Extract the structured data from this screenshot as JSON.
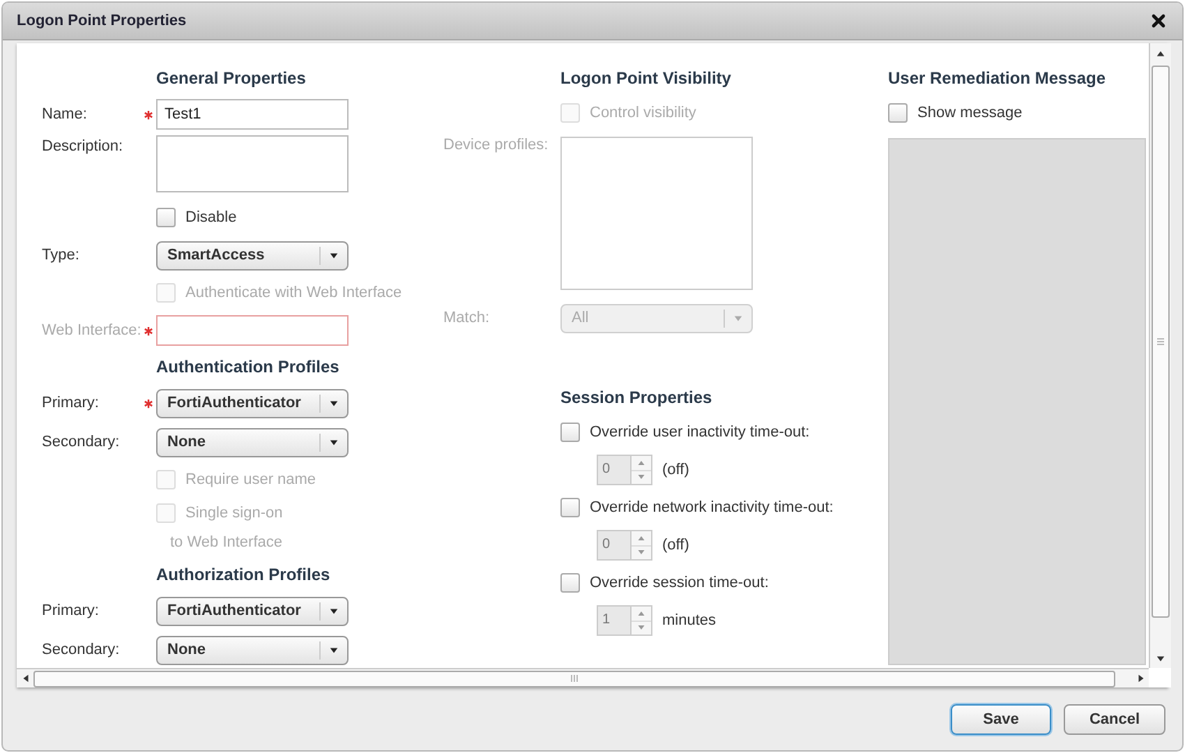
{
  "window": {
    "title": "Logon Point Properties"
  },
  "columns": [
    {
      "rows": [
        {
          "kind": "heading",
          "text": "General Properties"
        },
        {
          "kind": "text",
          "label": "Name:",
          "required": true,
          "value": "Test1",
          "disabled": false,
          "invalid": false
        },
        {
          "kind": "textarea",
          "label": "Description:",
          "disabled": false
        },
        {
          "kind": "checkbox",
          "label": "Disable",
          "checked": false,
          "disabled": false
        },
        {
          "kind": "select",
          "label": "Type:",
          "value": "SmartAccess",
          "disabled": false
        },
        {
          "kind": "checkbox",
          "label": "Authenticate with Web Interface",
          "checked": false,
          "disabled": true
        },
        {
          "kind": "text",
          "label": "Web Interface:",
          "required": true,
          "disabled": true,
          "invalid": true
        },
        {
          "kind": "heading",
          "text": "Authentication Profiles"
        },
        {
          "kind": "select",
          "label": "Primary:",
          "value": "FortiAuthenticator",
          "required": true,
          "disabled": false
        },
        {
          "kind": "select",
          "label": "Secondary:",
          "value": "None",
          "disabled": false
        },
        {
          "kind": "checkbox",
          "label": "Require user name",
          "checked": false,
          "disabled": true
        },
        {
          "kind": "checkbox",
          "label": "Single sign-on",
          "continuation": "to Web Interface",
          "checked": false,
          "disabled": true
        },
        {
          "kind": "heading",
          "text": "Authorization Profiles"
        },
        {
          "kind": "select",
          "label": "Primary:",
          "value": "FortiAuthenticator",
          "disabled": false
        },
        {
          "kind": "select",
          "label": "Secondary:",
          "value": "None",
          "disabled": false
        }
      ]
    },
    {
      "rows": [
        {
          "kind": "heading",
          "text": "Logon Point Visibility"
        },
        {
          "kind": "checkbox",
          "label": "Control visibility",
          "checked": false,
          "disabled": true
        },
        {
          "kind": "listbox",
          "label": "Device profiles:",
          "disabled": true
        },
        {
          "kind": "select",
          "label": "Match:",
          "value": "All",
          "disabled": true
        },
        {
          "kind": "spacer"
        },
        {
          "kind": "heading",
          "text": "Session Properties"
        },
        {
          "kind": "checkbox",
          "label": "Override user inactivity time-out:",
          "checked": false,
          "disabled": false
        },
        {
          "kind": "spinner",
          "value": "0",
          "unit": "(off)",
          "disabled": true
        },
        {
          "kind": "checkbox",
          "label": "Override network inactivity time-out:",
          "checked": false,
          "disabled": false
        },
        {
          "kind": "spinner",
          "value": "0",
          "unit": "(off)",
          "disabled": true
        },
        {
          "kind": "checkbox",
          "label": "Override session time-out:",
          "checked": false,
          "disabled": false
        },
        {
          "kind": "spinner",
          "value": "1",
          "unit": "minutes",
          "disabled": true
        }
      ]
    },
    {
      "rows": [
        {
          "kind": "heading",
          "text": "User Remediation Message"
        },
        {
          "kind": "checkbox",
          "label": "Show message",
          "checked": false,
          "disabled": false
        },
        {
          "kind": "message",
          "disabled": true
        }
      ]
    }
  ],
  "buttons": [
    {
      "label": "Save",
      "primary": true
    },
    {
      "label": "Cancel",
      "primary": false
    }
  ]
}
